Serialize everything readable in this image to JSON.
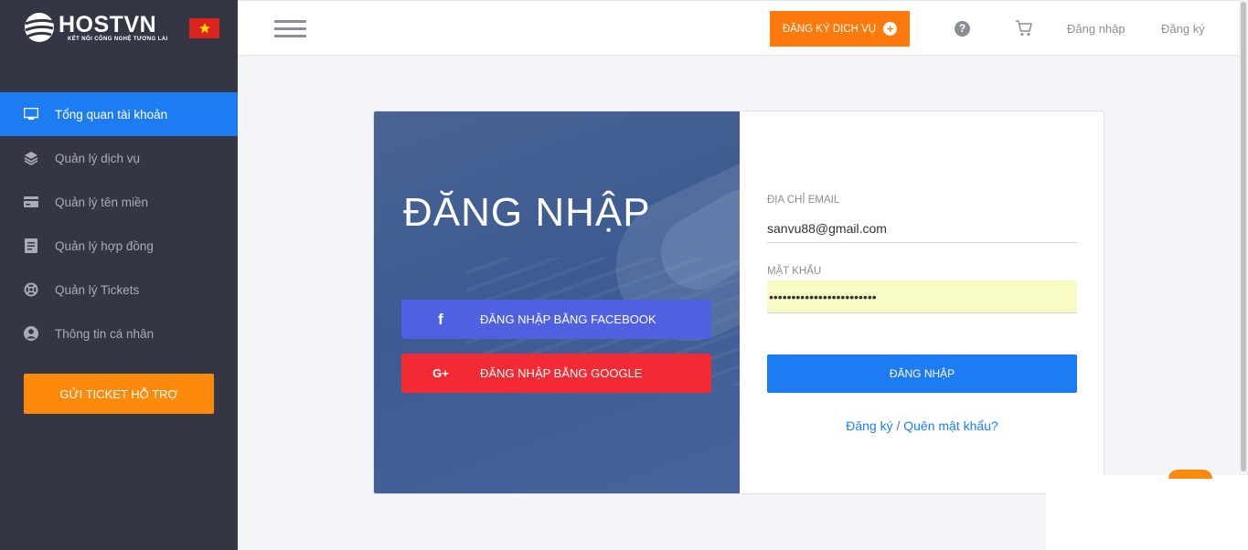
{
  "brand": {
    "name": "HOSTVN",
    "slogan": "KẾT NỐI CÔNG NGHỆ TƯƠNG LAI",
    "flag": "vietnam-flag"
  },
  "sidebar": {
    "items": [
      {
        "label": "Tổng quan tài khoản",
        "icon": "monitor-icon",
        "active": true
      },
      {
        "label": "Quản lý dịch vụ",
        "icon": "layers-icon"
      },
      {
        "label": "Quản lý tên miền",
        "icon": "card-icon"
      },
      {
        "label": "Quản lý hợp đồng",
        "icon": "document-icon"
      },
      {
        "label": "Quản lý Tickets",
        "icon": "lifebuoy-icon"
      },
      {
        "label": "Thông tin cá nhân",
        "icon": "user-icon"
      }
    ],
    "ticket_button": "GỬI TICKET HỖ TRỢ"
  },
  "header": {
    "register_service": "ĐĂNG KÝ DỊCH VỤ",
    "help": "?",
    "login": "Đăng nhập",
    "register": "Đăng ký"
  },
  "login": {
    "title": "ĐĂNG NHẬP",
    "facebook_label": "ĐĂNG NHẬP BẰNG FACEBOOK",
    "facebook_icon": "f",
    "google_label": "ĐĂNG NHẬP BẰNG GOOGLE",
    "google_icon": "G+",
    "email_label": "ĐỊA CHỈ EMAIL",
    "email_value": "sanvu88@gmail.com",
    "password_label": "MẬT KHẨU",
    "password_value": "••••••••••••••••••••••••",
    "submit": "ĐĂNG NHẬP",
    "register_link": "Đăng ký",
    "separator": "/",
    "forgot_link": "Quên mật khẩu?"
  },
  "colors": {
    "sidebar_bg": "#343645",
    "primary": "#1d7cf2",
    "orange": "#fe8a0c",
    "facebook": "#4f61e0",
    "google": "#f42b35"
  }
}
